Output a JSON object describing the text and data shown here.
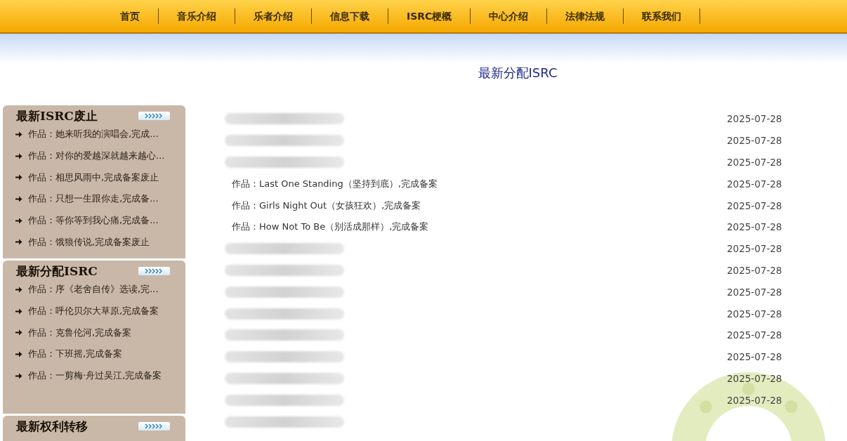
{
  "nav": [
    {
      "label": "首页"
    },
    {
      "label": "音乐介绍"
    },
    {
      "label": "乐者介绍"
    },
    {
      "label": "信息下载"
    },
    {
      "label": "ISRC梗概"
    },
    {
      "label": "中心介绍"
    },
    {
      "label": "法律法规"
    },
    {
      "label": "联系我们"
    }
  ],
  "sidebar": [
    {
      "title": "最新ISRC废止",
      "items": [
        "作品：她来听我的演唱会,完成...",
        "作品：对你的爱越深就越来越心...",
        "作品：相思风雨中,完成备案废止",
        "作品：只想一生跟你走,完成备...",
        "作品：等你等到我心痛,完成备...",
        "作品：饿狼传说,完成备案废止"
      ]
    },
    {
      "title": "最新分配ISRC",
      "items": [
        "作品：序《老舍自传》选读,完...",
        "作品：呼伦贝尔大草原,完成备案",
        "作品：克鲁伦河,完成备案",
        "作品：下班摇,完成备案",
        "作品：一剪梅·舟过吴江,完成备案"
      ]
    },
    {
      "title": "最新权利转移"
    }
  ],
  "heading": "最新分配ISRC",
  "rows": [
    {
      "blurred": true,
      "date": "2025-07-28"
    },
    {
      "blurred": true,
      "date": "2025-07-28"
    },
    {
      "blurred": true,
      "date": "2025-07-28"
    },
    {
      "blurred": false,
      "title": "作品：Last One Standing（坚持到底）,完成备案",
      "date": "2025-07-28"
    },
    {
      "blurred": false,
      "title": "作品：Girls Night Out（女孩狂欢）,完成备案",
      "date": "2025-07-28"
    },
    {
      "blurred": false,
      "title": "作品：How Not To Be（别活成那样）,完成备案",
      "date": "2025-07-28"
    },
    {
      "blurred": true,
      "date": "2025-07-28"
    },
    {
      "blurred": true,
      "date": "2025-07-28"
    },
    {
      "blurred": true,
      "date": "2025-07-28"
    },
    {
      "blurred": true,
      "date": "2025-07-28"
    },
    {
      "blurred": true,
      "date": "2025-07-28"
    },
    {
      "blurred": true,
      "date": "2025-07-28"
    },
    {
      "blurred": true,
      "date": "2025-07-28"
    },
    {
      "blurred": true,
      "date": "2025-07-28"
    },
    {
      "blurred": true
    }
  ]
}
